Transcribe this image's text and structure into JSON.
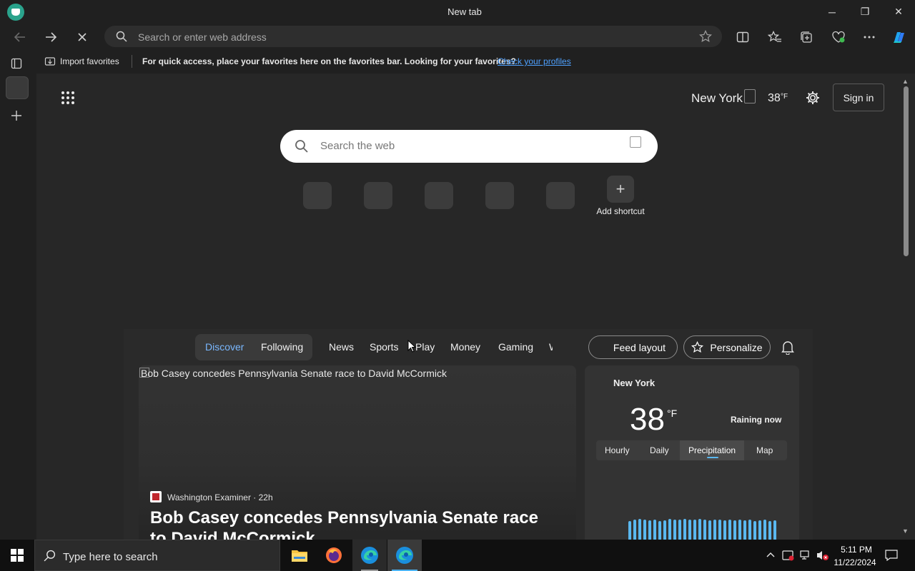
{
  "window": {
    "title": "New tab",
    "minimize_glyph": "─",
    "restore_glyph": "❐",
    "close_glyph": "✕"
  },
  "toolbar": {
    "address_placeholder": "Search or enter web address",
    "icons": [
      "back-icon",
      "forward-icon",
      "stop-icon",
      "search-icon",
      "favorite-star-icon",
      "split-screen-icon",
      "favorites-icon",
      "collections-icon",
      "browser-essentials-icon",
      "more-icon",
      "copilot-icon"
    ]
  },
  "favorites_bar": {
    "import_label": "Import favorites",
    "message": "For quick access, place your favorites here on the favorites bar. Looking for your favorites?",
    "link": "Check your profiles"
  },
  "header": {
    "city": "New York",
    "temp": "38",
    "unit": "°F",
    "sign_in": "Sign in"
  },
  "search": {
    "placeholder": "Search the web"
  },
  "shortcuts": {
    "add_label": "Add shortcut",
    "add_glyph": "+"
  },
  "feed": {
    "tabs": [
      "Discover",
      "Following",
      "News",
      "Sports",
      "Play",
      "Money",
      "Gaming",
      "W"
    ],
    "active_tab": "Discover",
    "feed_layout_label": "Feed layout",
    "personalize_label": "Personalize"
  },
  "article": {
    "image_alt": "Bob Casey concedes Pennsylvania Senate race to David McCormick",
    "source": "Washington Examiner",
    "age": "22h",
    "source_line": "Washington Examiner · 22h",
    "headline": "Bob Casey concedes Pennsylvania Senate race to David McCormick"
  },
  "weather": {
    "city": "New York",
    "temp": "38",
    "unit": "°F",
    "condition": "Raining now",
    "tabs": [
      "Hourly",
      "Daily",
      "Precipitation",
      "Map"
    ],
    "active_tab": "Precipitation"
  },
  "taskbar": {
    "search_placeholder": "Type here to search",
    "time": "5:11 PM",
    "date": "11/22/2024"
  },
  "colors": {
    "accent_link": "#4ea1ff",
    "active_tab": "#7ab8ff",
    "precip_bar": "#5ab8f0"
  }
}
